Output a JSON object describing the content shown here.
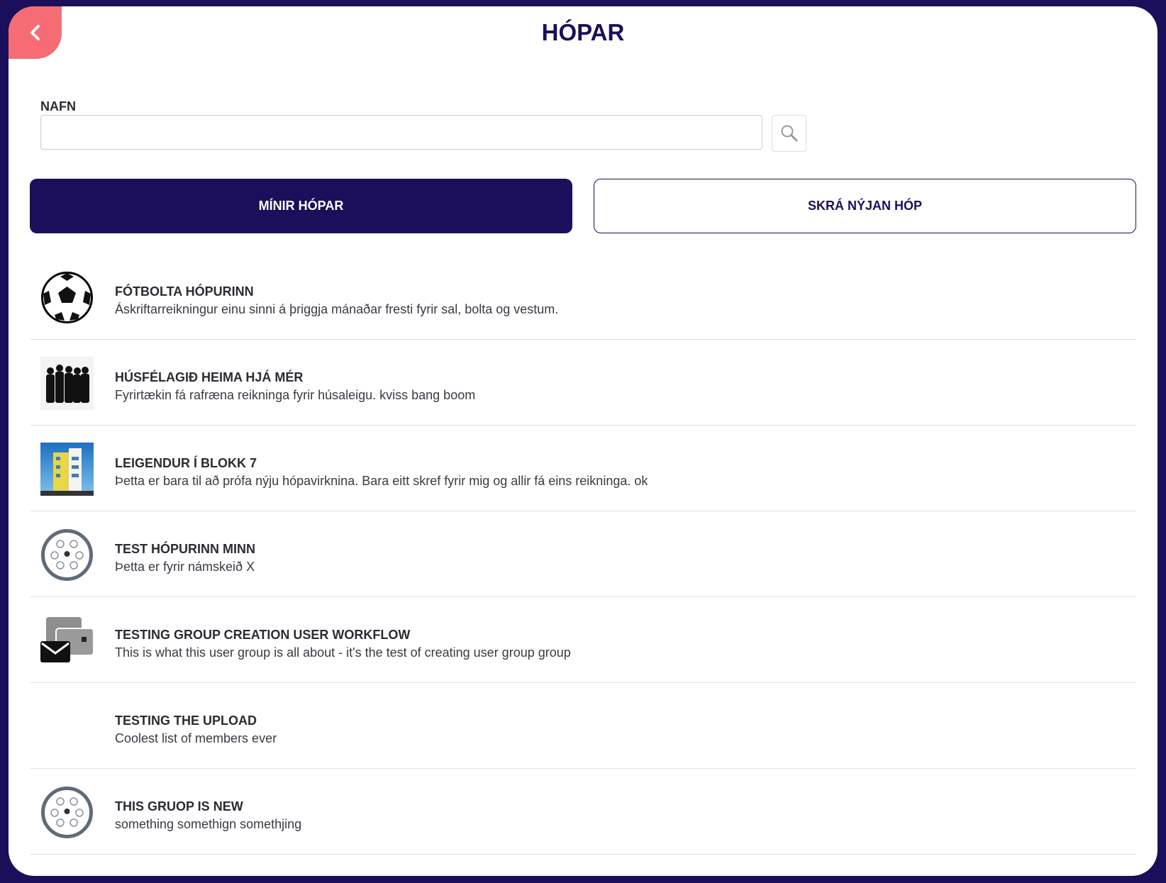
{
  "header": {
    "title": "HÓPAR",
    "back_icon": "chevron-left-icon"
  },
  "search": {
    "label": "NAFN",
    "value": "",
    "placeholder": "",
    "icon": "search-icon"
  },
  "tabs": {
    "my_groups": "MÍNIR HÓPAR",
    "register_group": "SKRÁ NÝJAN HÓP"
  },
  "colors": {
    "navy": "#1b0f5b",
    "coral": "#f66c74"
  },
  "groups": [
    {
      "name": "FÓTBOLTA HÓPURINN",
      "description": "Áskriftarreikningur einu sinni á þriggja mánaðar fresti fyrir sal, bolta og vestum.",
      "icon": "soccer-ball-icon"
    },
    {
      "name": "HÚSFÉLAGIÐ HEIMA HJÁ MÉR",
      "description": "Fyrirtækin fá rafræna reikninga fyrir húsaleigu. kviss bang boom",
      "icon": "people-silhouette-icon"
    },
    {
      "name": "LEIGENDUR Í BLOKK 7",
      "description": "Þetta er bara til að prófa nýju hópavirknina. Bara eitt skref fyrir mig og allir fá eins reikninga. ok",
      "icon": "building-icon"
    },
    {
      "name": "TEST HÓPURINN MINN",
      "description": "Þetta er fyrir námskeið X",
      "icon": "group-circle-icon"
    },
    {
      "name": "TESTING GROUP CREATION USER WORKFLOW",
      "description": "This is what this user group is all about - it's the test of creating user group group",
      "icon": "mail-wallet-icon"
    },
    {
      "name": "TESTING THE UPLOAD",
      "description": "Coolest list of members ever",
      "icon": ""
    },
    {
      "name": "THIS GRUOP IS NEW",
      "description": "something somethign somethjing",
      "icon": "group-circle-icon"
    }
  ]
}
